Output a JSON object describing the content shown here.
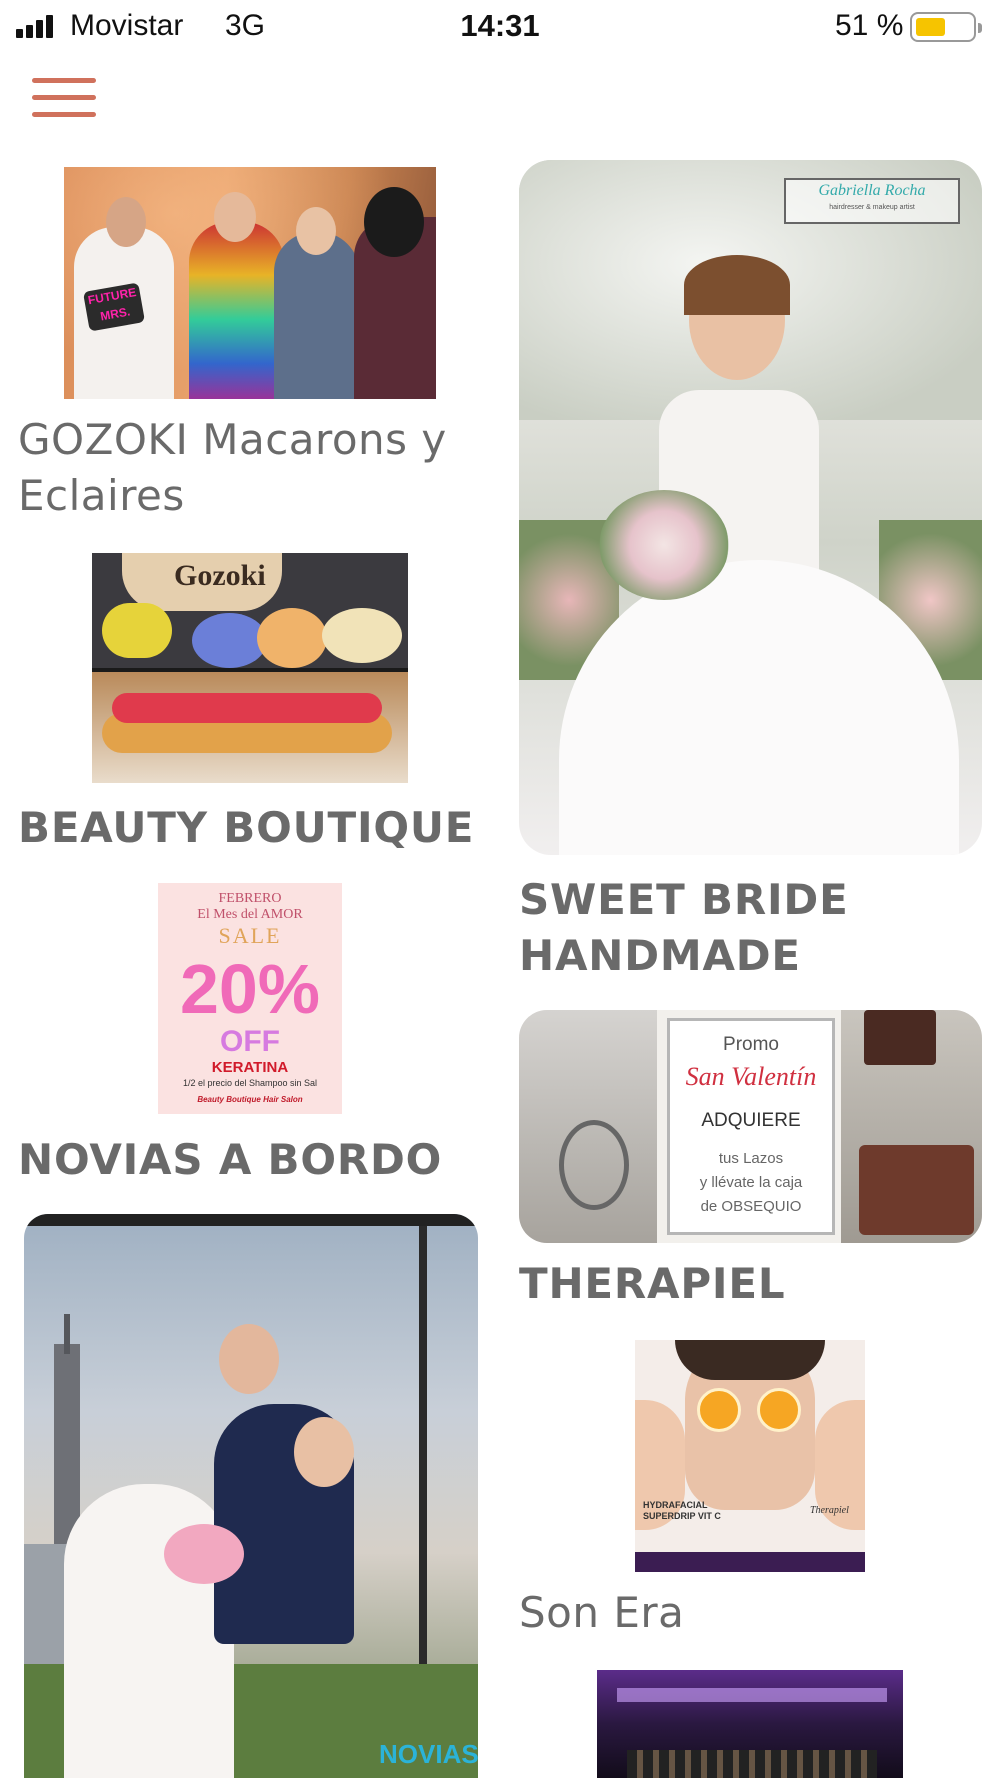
{
  "status_bar": {
    "carrier": "Movistar",
    "network": "3G",
    "time": "14:31",
    "battery_percent": "51 %",
    "battery_level": 0.51,
    "battery_color": "#f6c400"
  },
  "header": {
    "menu_icon": "hamburger-menu-icon",
    "accent_color": "#d0715c"
  },
  "listings": {
    "left": [
      {
        "title": "GOZOKI Macarons y Eclaires"
      },
      {
        "title": "BEAUTY BOUTIQUE"
      },
      {
        "title": "NOVIAS A BORDO"
      }
    ],
    "right": [
      {
        "title": "SWEET BRIDE HANDMADE"
      },
      {
        "title": "THERAPIEL"
      },
      {
        "title": "Son Era"
      }
    ]
  },
  "images": {
    "photobooth": {
      "sign_text": "FUTURE MRS."
    },
    "gozoki": {
      "logo_text": "Gozoki"
    },
    "sale": {
      "line1": "FEBRERO",
      "line2": "El Mes del AMOR",
      "line3": "SALE",
      "discount": "20%",
      "off": "OFF",
      "product": "KERATINA",
      "subtext": "1/2 el precio del Shampoo sin Sal",
      "brand": "Beauty Boutique Hair Salon"
    },
    "bride": {
      "watermark": "Gabriella Rocha",
      "watermark_sub": "hairdresser & makeup artist"
    },
    "rosary": {
      "line1": "Promo",
      "line2": "San Valentín",
      "line3": "ADQUIERE",
      "line4": "tus Lazos",
      "line5": "y llévate la caja",
      "line6": "de OBSEQUIO"
    },
    "spa": {
      "line1": "HYDRAFACIAL",
      "line2": "SUPERDRIP VIT C",
      "brand": "Therapiel"
    },
    "novias": {
      "logo_text": "NOVIAS"
    }
  }
}
